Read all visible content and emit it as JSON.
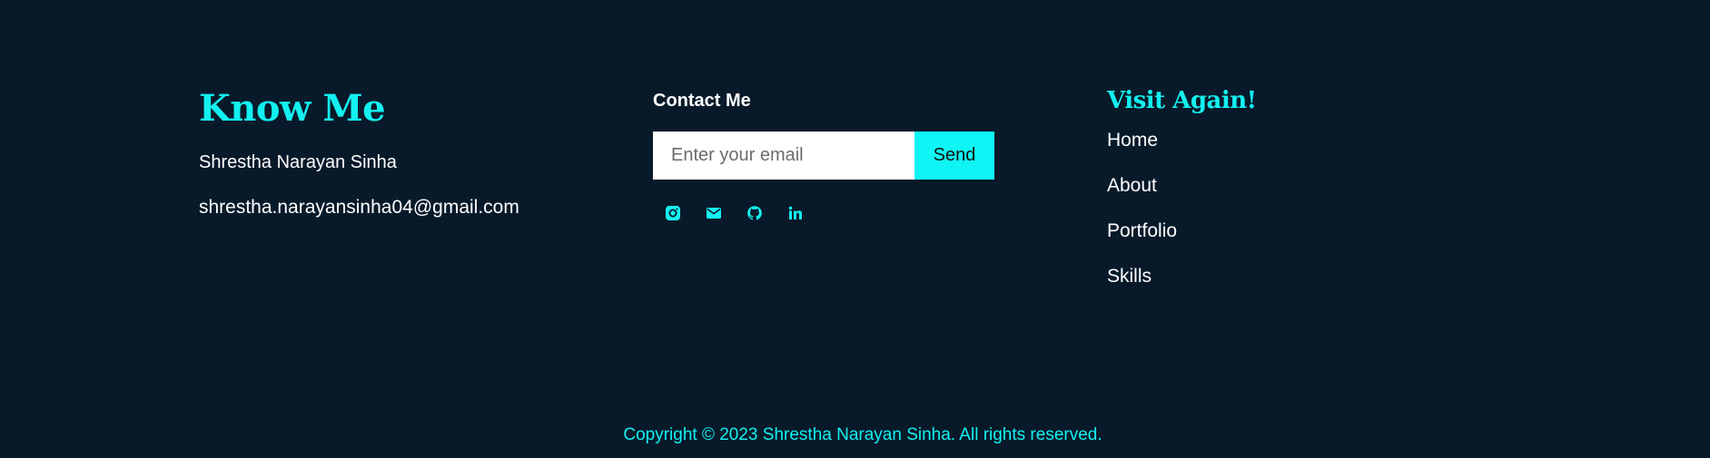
{
  "know": {
    "title": "Know Me",
    "name": "Shrestha Narayan Sinha",
    "email": "shrestha.narayansinha04@gmail.com"
  },
  "contact": {
    "title": "Contact Me",
    "input_placeholder": "Enter your email",
    "send_label": "Send",
    "socials": [
      "instagram-icon",
      "mail-icon",
      "github-icon",
      "linkedin-icon"
    ]
  },
  "visit": {
    "title": "Visit Again!",
    "links": [
      "Home",
      "About",
      "Portfolio",
      "Skills"
    ]
  },
  "copyright": "Copyright © 2023 Shrestha Narayan Sinha. All rights reserved.",
  "colors": {
    "background": "#081a2a",
    "accent": "#13f0f0",
    "button": "#0ff5f5",
    "text": "#ffffff"
  }
}
